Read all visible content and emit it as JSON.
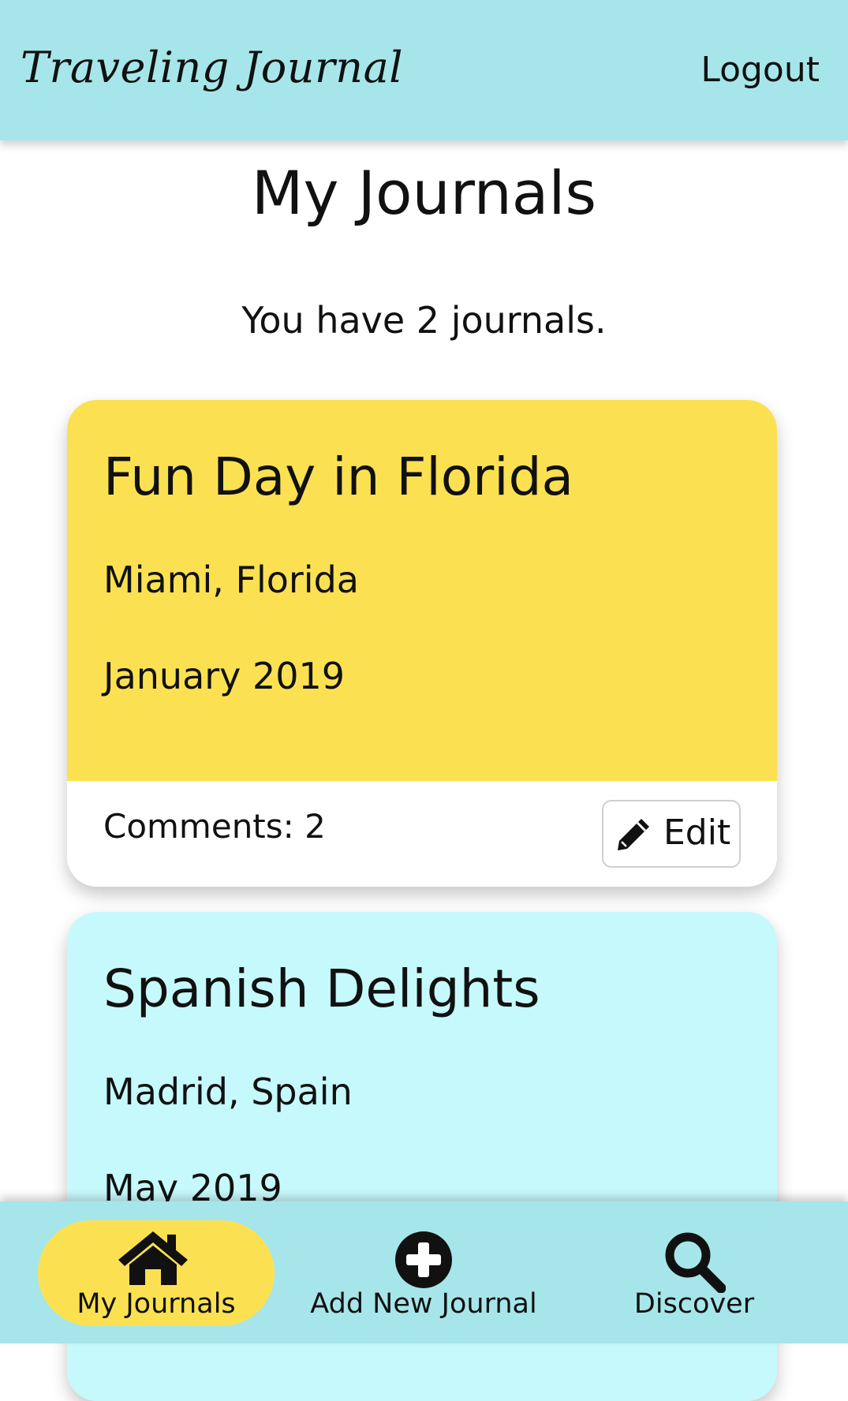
{
  "header": {
    "brand": "Traveling Journal",
    "logout_label": "Logout"
  },
  "main": {
    "title": "My Journals",
    "count_text": "You have 2 journals."
  },
  "journals": [
    {
      "title": "Fun Day in Florida",
      "location": "Miami, Florida",
      "date": "January 2019",
      "comments_label": "Comments: 2",
      "edit_label": "Edit",
      "color": "#fbe151"
    },
    {
      "title": "Spanish Delights",
      "location": "Madrid, Spain",
      "date": "May 2019",
      "color": "#c6f9fb"
    }
  ],
  "bottom_nav": {
    "items": [
      {
        "label": "My Journals",
        "icon": "home-icon",
        "active": true
      },
      {
        "label": "Add New Journal",
        "icon": "plus-circle-icon",
        "active": false
      },
      {
        "label": "Discover",
        "icon": "search-icon",
        "active": false
      }
    ]
  },
  "colors": {
    "bar": "#a6e6ea",
    "accent_yellow": "#fbe151",
    "card_cyan": "#c6f9fb"
  }
}
